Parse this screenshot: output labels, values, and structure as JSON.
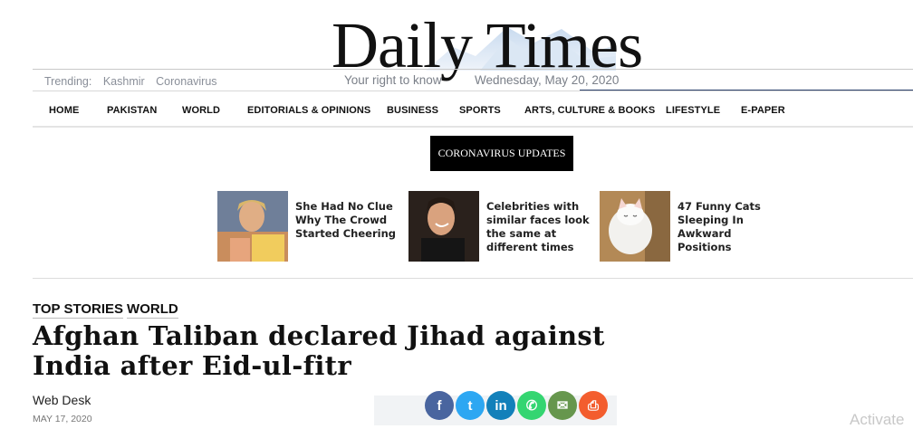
{
  "masthead": {
    "logo": "Daily Times",
    "tagline": "Your right to know",
    "date": "Wednesday, May 20, 2020"
  },
  "trending": {
    "label": "Trending:",
    "items": [
      "Kashmir",
      "Coronavirus"
    ]
  },
  "nav": {
    "items": [
      "HOME",
      "PAKISTAN",
      "WORLD",
      "EDITORIALS & OPINIONS",
      "BUSINESS",
      "SPORTS",
      "ARTS, CULTURE & BOOKS",
      "LIFESTYLE",
      "E-PAPER"
    ]
  },
  "corona_button": "CORONAVIRUS UPDATES",
  "promoted": [
    {
      "title": "She Had No Clue Why The Crowd Started Cheering"
    },
    {
      "title": "Celebrities with similar faces look the same at different times"
    },
    {
      "title": "47 Funny Cats Sleeping In Awkward Positions"
    }
  ],
  "article": {
    "categories": [
      "TOP STORIES",
      "WORLD"
    ],
    "headline": "Afghan Taliban declared Jihad against India after Eid-ul-fitr",
    "author": "Web Desk",
    "date": "MAY 17, 2020"
  },
  "share": [
    {
      "name": "facebook",
      "glyph": "f",
      "color": "#3b5998"
    },
    {
      "name": "twitter",
      "glyph": "t",
      "color": "#1da1f2"
    },
    {
      "name": "linkedin",
      "glyph": "in",
      "color": "#0077b5"
    },
    {
      "name": "whatsapp",
      "glyph": "✆",
      "color": "#25d366"
    },
    {
      "name": "email",
      "glyph": "✉",
      "color": "#5b8f3f"
    },
    {
      "name": "print",
      "glyph": "⎙",
      "color": "#f4511e"
    }
  ],
  "watermark": "Activate"
}
